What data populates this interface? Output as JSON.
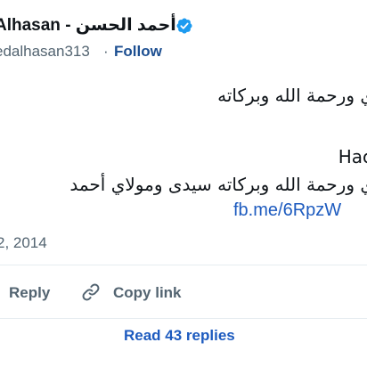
{
  "header": {
    "display_name": "Alhasan - أحمد الحسن",
    "handle": "edalhasan313",
    "separator": "·",
    "follow_label": "Follow"
  },
  "tweet": {
    "line1": "ي ورحمة الله وبركاته",
    "line2": "Hac",
    "line3": "ي ورحمة الله وبركاته سيدى ومولاي أحمد",
    "link_text": "fb.me/6RpzW",
    "timestamp": "2, 2014"
  },
  "actions": {
    "reply_label": "Reply",
    "copy_link_label": "Copy link"
  },
  "footer": {
    "read_replies_label": "Read 43 replies"
  },
  "colors": {
    "verified": "#1d9bf0",
    "link": "#1d5bbf",
    "muted": "#536471",
    "text": "#0f1419"
  },
  "icons": {
    "verified": "verified-badge-icon",
    "reply": "reply-icon",
    "copy_link": "link-icon"
  }
}
